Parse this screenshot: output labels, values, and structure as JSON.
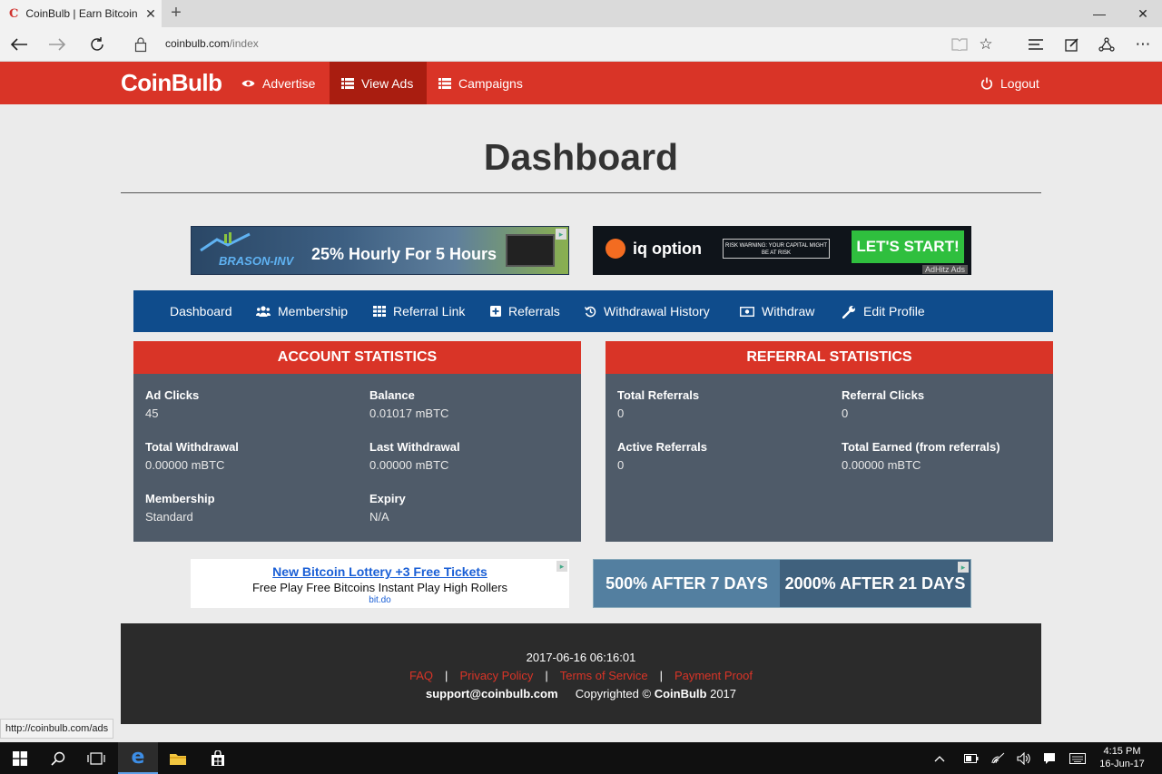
{
  "browser": {
    "tab_title": "CoinBulb | Earn Bitcoin",
    "tab_favicon": "C",
    "url_host": "coinbulb.com",
    "url_path": "/index",
    "status_url": "http://coinbulb.com/ads"
  },
  "site": {
    "logo": "CoinBulb",
    "nav": [
      {
        "label": "Advertise",
        "icon": "eye-icon"
      },
      {
        "label": "View Ads",
        "icon": "list-icon"
      },
      {
        "label": "Campaigns",
        "icon": "list-icon"
      }
    ],
    "logout_label": "Logout",
    "brand_color": "#d93427"
  },
  "page_title": "Dashboard",
  "ads": {
    "top_left": {
      "brand": "BRASON-INV",
      "text": "25% Hourly For 5 Hours"
    },
    "top_right": {
      "brand": "iq option",
      "warning": "RISK WARNING: YOUR CAPITAL MIGHT BE AT RISK",
      "cta": "LET'S START!",
      "by": "AdHitz Ads"
    },
    "bottom_left": {
      "headline": "New Bitcoin Lottery +3 Free Tickets",
      "text": "Free Play Free Bitcoins Instant Play High Rollers",
      "url": "bit.do"
    },
    "bottom_right": {
      "left": "500% AFTER 7 DAYS",
      "right": "2000% AFTER 21 DAYS"
    }
  },
  "dashboard_menu": [
    {
      "label": "Dashboard"
    },
    {
      "label": "Membership"
    },
    {
      "label": "Referral Link"
    },
    {
      "label": "Referrals"
    },
    {
      "label": "Withdrawal History"
    },
    {
      "label": "Withdraw"
    },
    {
      "label": "Edit Profile"
    }
  ],
  "account_statistics": {
    "title": "ACCOUNT STATISTICS",
    "ad_clicks": {
      "label": "Ad Clicks",
      "value": "45"
    },
    "balance": {
      "label": "Balance",
      "value": "0.01017 mBTC"
    },
    "total_withdrawal": {
      "label": "Total Withdrawal",
      "value": "0.00000 mBTC"
    },
    "last_withdrawal": {
      "label": "Last Withdrawal",
      "value": "0.00000 mBTC"
    },
    "membership": {
      "label": "Membership",
      "value": "Standard"
    },
    "expiry": {
      "label": "Expiry",
      "value": "N/A"
    }
  },
  "referral_statistics": {
    "title": "REFERRAL STATISTICS",
    "total_referrals": {
      "label": "Total Referrals",
      "value": "0"
    },
    "referral_clicks": {
      "label": "Referral Clicks",
      "value": "0"
    },
    "active_referrals": {
      "label": "Active Referrals",
      "value": "0"
    },
    "total_earned": {
      "label": "Total Earned (from referrals)",
      "value": "0.00000 mBTC"
    }
  },
  "footer": {
    "datetime": "2017-06-16 06:16:01",
    "links": [
      "FAQ",
      "Privacy Policy",
      "Terms of Service",
      "Payment Proof"
    ],
    "support_email": "support@coinbulb.com",
    "copyright_prefix": "Copyrighted ©",
    "copyright_brand": "CoinBulb",
    "copyright_year": "2017"
  },
  "taskbar": {
    "time": "4:15 PM",
    "date": "16-Jun-17"
  }
}
